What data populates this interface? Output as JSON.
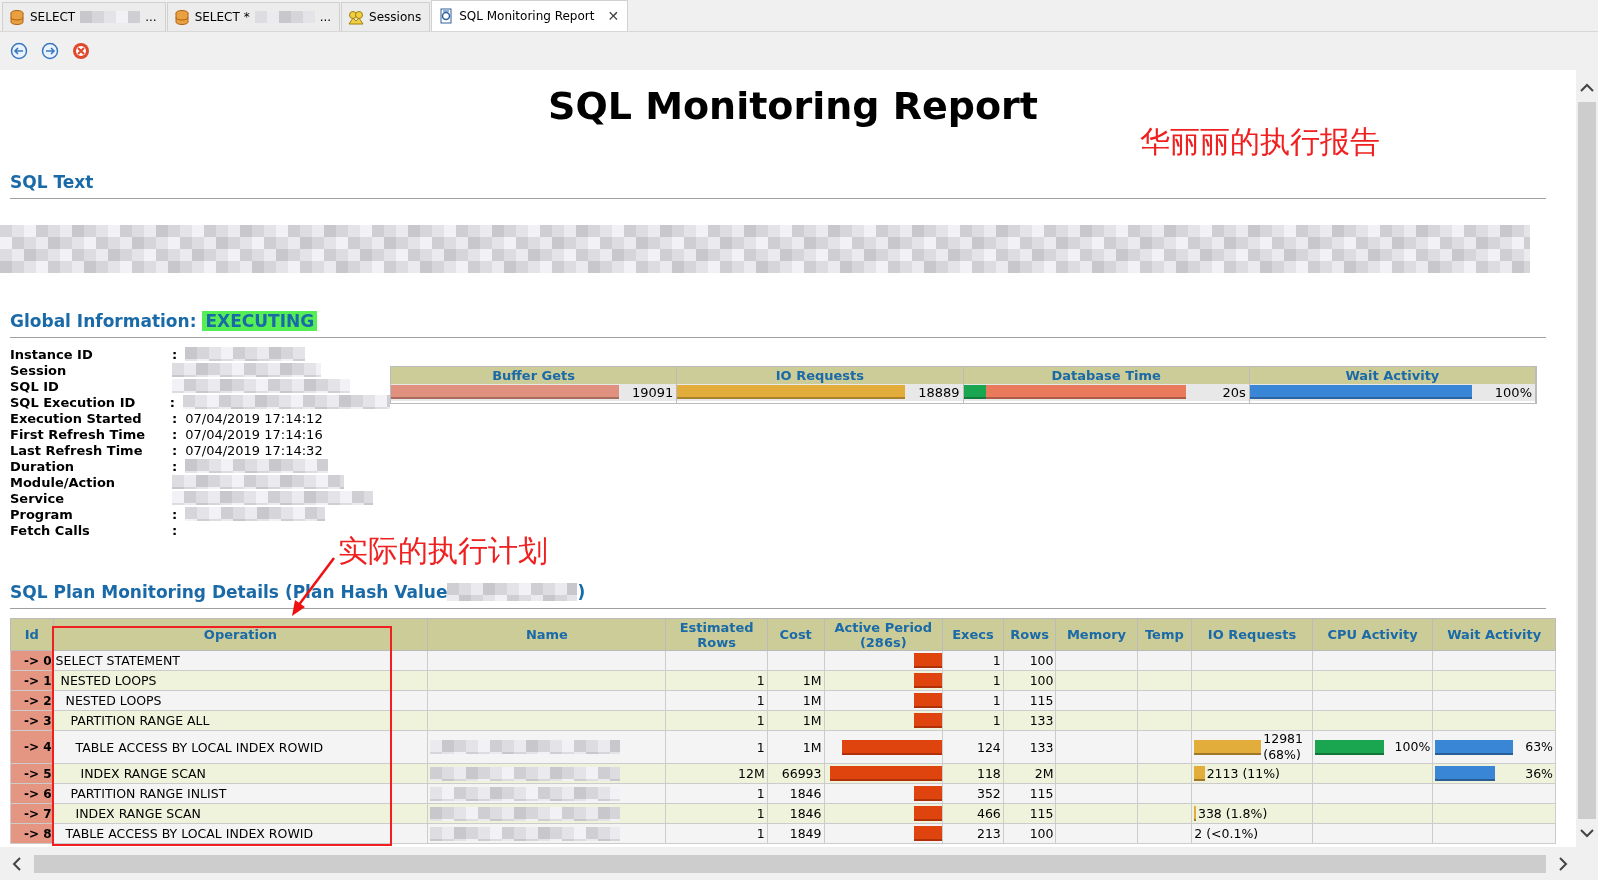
{
  "tabs": [
    {
      "label": "SELECT",
      "redacted": true,
      "tail": "...",
      "kind": "database",
      "selected": false
    },
    {
      "label": "SELECT *",
      "redacted": true,
      "tail": "...",
      "kind": "database",
      "selected": false
    },
    {
      "label": "Sessions",
      "kind": "sessions",
      "selected": false
    },
    {
      "label": "SQL Monitoring Report",
      "kind": "report",
      "close": "✕",
      "selected": true
    }
  ],
  "toolbar": [
    {
      "kind": "back"
    },
    {
      "kind": "forward"
    },
    {
      "kind": "stop"
    }
  ],
  "report": {
    "title": "SQL Monitoring Report",
    "annotation": "华丽丽的执行报告",
    "sql_text": {
      "heading": "SQL Text",
      "redacted": true
    },
    "global": {
      "heading": "Global Information:",
      "status": "EXECUTING",
      "fields": [
        {
          "label": "Instance ID",
          "colon": ":",
          "redacted": true
        },
        {
          "label": "Session",
          "redacted": true
        },
        {
          "label": "SQL ID",
          "redacted": true
        },
        {
          "label": "SQL Execution ID",
          "colon": ":",
          "redacted": true
        },
        {
          "label": "Execution Started",
          "colon": ":",
          "value": "07/04/2019 17:14:12"
        },
        {
          "label": "First Refresh Time",
          "colon": ":",
          "value": "07/04/2019 17:14:16"
        },
        {
          "label": "Last Refresh Time",
          "colon": ":",
          "value": "07/04/2019 17:14:32"
        },
        {
          "label": "Duration",
          "colon": ":",
          "redacted": true
        },
        {
          "label": "Module/Action",
          "redacted": true
        },
        {
          "label": "Service",
          "redacted": true
        },
        {
          "label": "Program",
          "colon": ":",
          "redacted": true
        },
        {
          "label": "Fetch Calls",
          "colon": ":"
        }
      ],
      "metrics": [
        {
          "label": "Buffer Gets",
          "reading": "19091",
          "segments": [
            {
              "color": "#e0907e",
              "level": 0.8
            }
          ]
        },
        {
          "label": "IO Requests",
          "reading": "18889",
          "segments": [
            {
              "color": "#e2ad3a",
              "level": 0.8
            }
          ]
        },
        {
          "label": "Database Time",
          "reading": "20s",
          "segments": [
            {
              "color": "#1aa650",
              "level": 0.08
            },
            {
              "color": "#e97a5c",
              "level": 0.78
            }
          ]
        },
        {
          "label": "Wait Activity",
          "reading": "100%",
          "segments": [
            {
              "color": "#3a86d6",
              "level": 0.78
            }
          ]
        }
      ]
    },
    "plan": {
      "heading": "SQL Plan Monitoring Details (Plan Hash Value",
      "heading_end": ")",
      "hash_redacted": true,
      "annotation": "实际的执行计划",
      "columns": [
        "Id",
        "Operation",
        "Name",
        "Estimated Rows",
        "Cost",
        "Active Period (286s)",
        "Execs",
        "Rows",
        "Memory",
        "Temp",
        "IO Requests",
        "CPU Activity",
        "Wait Activity"
      ],
      "rows": [
        {
          "id": "-> 0",
          "operation": "SELECT STATEMENT",
          "active": {
            "level": 0.24
          },
          "execs": "1",
          "rows": "100",
          "children": [
            {
              "id": "-> 1",
              "operation": "NESTED LOOPS",
              "est_rows": "1",
              "cost": "1M",
              "active": {
                "level": 0.24
              },
              "execs": "1",
              "rows": "100",
              "children": [
                {
                  "id": "-> 2",
                  "operation": "NESTED LOOPS",
                  "est_rows": "1",
                  "cost": "1M",
                  "active": {
                    "level": 0.24
                  },
                  "execs": "1",
                  "rows": "115",
                  "children": [
                    {
                      "id": "-> 3",
                      "operation": "PARTITION RANGE ALL",
                      "est_rows": "1",
                      "cost": "1M",
                      "active": {
                        "level": 0.24
                      },
                      "execs": "1",
                      "rows": "133",
                      "children": [
                        {
                          "id": "-> 4",
                          "operation": "TABLE ACCESS BY LOCAL INDEX ROWID",
                          "name_redacted": true,
                          "est_rows": "1",
                          "cost": "1M",
                          "active": {
                            "level": 0.85
                          },
                          "execs": "124",
                          "rows": "133",
                          "io": {
                            "level": 0.58,
                            "reading": "12981 (68%)"
                          },
                          "cpu": {
                            "level": 0.6,
                            "reading": "100%"
                          },
                          "wait": {
                            "level": 0.66,
                            "reading": "63%"
                          },
                          "children": [
                            {
                              "id": "-> 5",
                              "operation": "INDEX RANGE SCAN",
                              "name_redacted": true,
                              "est_rows": "12M",
                              "cost": "66993",
                              "active": {
                                "level": 0.95
                              },
                              "execs": "118",
                              "rows": "2M",
                              "io": {
                                "level": 0.09,
                                "reading": "2113 (11%)"
                              },
                              "wait": {
                                "level": 0.51,
                                "reading": "36%"
                              }
                            }
                          ]
                        }
                      ]
                    },
                    {
                      "id": "-> 6",
                      "operation": "PARTITION RANGE INLIST",
                      "name_redacted": true,
                      "est_rows": "1",
                      "cost": "1846",
                      "active": {
                        "level": 0.24
                      },
                      "execs": "352",
                      "rows": "115",
                      "children": [
                        {
                          "id": "-> 7",
                          "operation": "INDEX RANGE SCAN",
                          "name_redacted": true,
                          "est_rows": "1",
                          "cost": "1846",
                          "active": {
                            "level": 0.24
                          },
                          "execs": "466",
                          "rows": "115",
                          "io": {
                            "level": 0.015,
                            "reading": "338 (1.8%)"
                          }
                        }
                      ]
                    }
                  ]
                },
                {
                  "id": "-> 8",
                  "operation": "TABLE ACCESS BY LOCAL INDEX ROWID",
                  "name_redacted": true,
                  "est_rows": "1",
                  "cost": "1849",
                  "active": {
                    "level": 0.24
                  },
                  "execs": "213",
                  "rows": "100",
                  "io": {
                    "reading": "2 (<0.1%)"
                  }
                }
              ]
            }
          ]
        }
      ]
    }
  }
}
